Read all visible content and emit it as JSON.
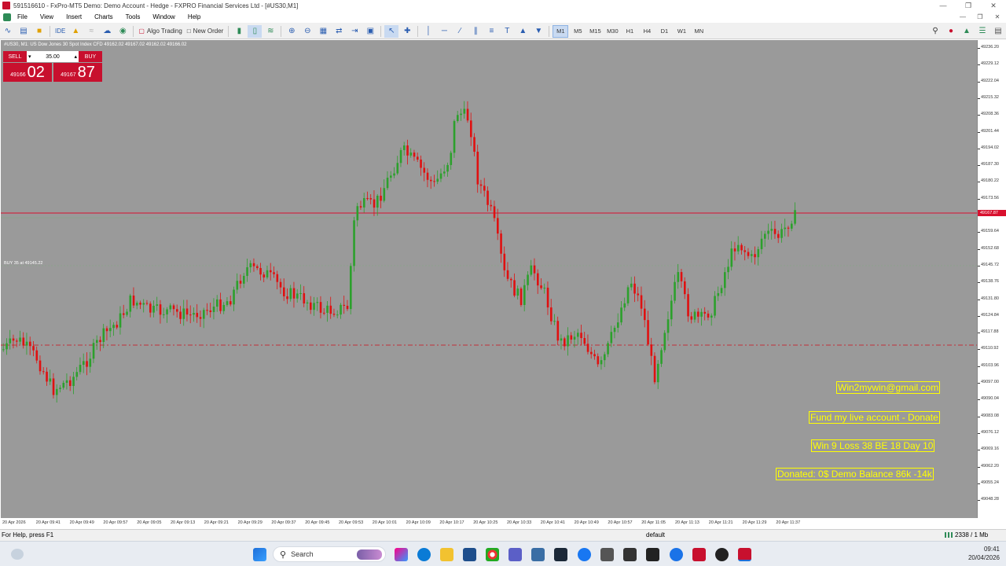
{
  "window": {
    "title": "591516610 - FxPro-MT5 Demo: Demo Account - Hedge - FXPRO Financial Services Ltd - [#US30,M1]"
  },
  "menu": [
    "File",
    "View",
    "Insert",
    "Charts",
    "Tools",
    "Window",
    "Help"
  ],
  "toolbar": {
    "algo_label": "Algo Trading",
    "new_order_label": "New Order",
    "ide_label": "IDE",
    "timeframes": [
      "M1",
      "M5",
      "M15",
      "M30",
      "H1",
      "H4",
      "D1",
      "W1",
      "MN"
    ],
    "active_timeframe": "M1"
  },
  "chart": {
    "symbol_line": "#US30, M1:  US Dow Jones 30 Spot Index CFD   49162.02 49167.02 49162.02 49166.02",
    "one_click": {
      "sell_label": "SELL",
      "buy_label": "BUY",
      "volume": "35.00",
      "sell_small": "49166",
      "sell_big": "02",
      "buy_small": "49167",
      "buy_big": "87"
    },
    "position_label": "BUY 35 at 49145.22",
    "price_ticks": [
      "49236.20",
      "49229.12",
      "49222.04",
      "49215.32",
      "49208.36",
      "49201.44",
      "49194.02",
      "49187.30",
      "49180.22",
      "49173.56",
      "49166.02",
      "49159.64",
      "49152.68",
      "49145.72",
      "49138.76",
      "49131.80",
      "49124.84",
      "49117.88",
      "49110.92",
      "49103.96",
      "49097.00",
      "49090.04",
      "49083.08",
      "49076.12",
      "49069.16",
      "49062.20",
      "49055.24",
      "49048.28"
    ],
    "current_price_tag": "49167.87",
    "time_ticks": [
      "20 Apr 2026",
      "20 Apr 09:41",
      "20 Apr 09:49",
      "20 Apr 09:57",
      "20 Apr 09:05",
      "20 Apr 09:13",
      "20 Apr 09:21",
      "20 Apr 09:29",
      "20 Apr 09:37",
      "20 Apr 09:45",
      "20 Apr 09:53",
      "20 Apr 10:01",
      "20 Apr 10:09",
      "20 Apr 10:17",
      "20 Apr 10:25",
      "20 Apr 10:33",
      "20 Apr 10:41",
      "20 Apr 10:49",
      "20 Apr 10:57",
      "20 Apr 11:05",
      "20 Apr 11:13",
      "20 Apr 11:21",
      "20 Apr 11:29",
      "20 Apr 11:37"
    ],
    "notes": [
      "Win2mywin@gmail.com",
      "Fund my live account - Donate",
      "Win 9  Loss 38  BE 18  Day 10",
      "Donated: 0$  Demo Balance 86k -14k"
    ],
    "colors": {
      "bg": "#9a9a9a",
      "bull": "#2ca02c",
      "bear": "#e01010",
      "note": "#ffff00",
      "ask_line": "#d8102e"
    }
  },
  "statusbar": {
    "help": "For Help, press F1",
    "profile": "default",
    "connection": "2338 / 1 Mb"
  },
  "taskbar": {
    "search_placeholder": "Search",
    "time": "09:41",
    "date": "20/04/2026"
  }
}
